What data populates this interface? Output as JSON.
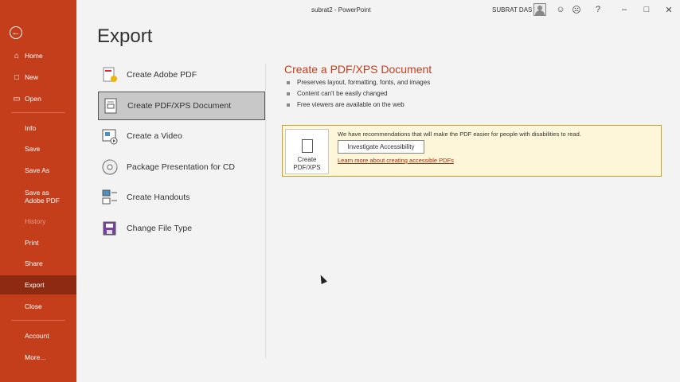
{
  "window": {
    "title": "subrat2  -  PowerPoint",
    "user_name": "SUBRAT DAS",
    "help_label": "?",
    "accent_color": "#c43e1c"
  },
  "sidebar": {
    "back_icon": "back-arrow-icon",
    "items": [
      {
        "label": "Home",
        "icon": "home-icon"
      },
      {
        "label": "New",
        "icon": "new-doc-icon"
      },
      {
        "label": "Open",
        "icon": "folder-icon"
      },
      {
        "label": "Info"
      },
      {
        "label": "Save"
      },
      {
        "label": "Save As"
      },
      {
        "label": "Save as Adobe PDF"
      },
      {
        "label": "History",
        "disabled": true
      },
      {
        "label": "Print"
      },
      {
        "label": "Share"
      },
      {
        "label": "Export",
        "selected": true
      },
      {
        "label": "Close"
      },
      {
        "label": "Account"
      },
      {
        "label": "More..."
      }
    ]
  },
  "page": {
    "heading": "Export"
  },
  "options": [
    {
      "label": "Create Adobe PDF",
      "icon": "adobe-pdf-icon"
    },
    {
      "label": "Create PDF/XPS Document",
      "icon": "pdf-xps-icon",
      "selected": true
    },
    {
      "label": "Create a Video",
      "icon": "video-icon"
    },
    {
      "label": "Package Presentation for CD",
      "icon": "cd-icon"
    },
    {
      "label": "Create Handouts",
      "icon": "handouts-icon"
    },
    {
      "label": "Change File Type",
      "icon": "change-file-type-icon"
    }
  ],
  "detail": {
    "title": "Create a PDF/XPS Document",
    "bullets": [
      "Preserves layout, formatting, fonts, and images",
      "Content can't be easily changed",
      "Free viewers are available on the web"
    ],
    "recommendation": {
      "text": "We have recommendations that will make the PDF easier for people with disabilities to read.",
      "button_label": "Investigate Accessibility",
      "link_text": "Learn more about creating accessible PDFs"
    },
    "create_button_line1": "Create",
    "create_button_line2": "PDF/XPS"
  }
}
